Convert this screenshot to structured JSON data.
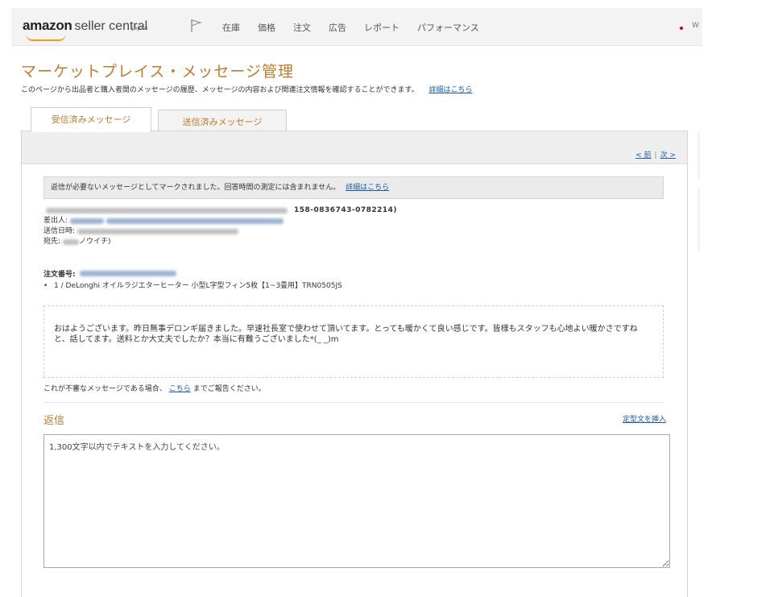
{
  "header": {
    "logo_brand": "amazon",
    "logo_product": "seller central",
    "logo_region": "japan",
    "nav_items": [
      "在庫",
      "価格",
      "注文",
      "広告",
      "レポート",
      "パフォーマンス"
    ],
    "user_text": "W"
  },
  "page": {
    "title": "マーケットプレイス・メッセージ管理",
    "description": "このページから出品者と購入者間のメッセージの履歴、メッセージの内容および関連注文情報を確認することができます。",
    "details_link": "詳細はこちら"
  },
  "tabs": [
    {
      "label": "受信済みメッセージ",
      "active": true
    },
    {
      "label": "送信済みメッセージ",
      "active": false
    }
  ],
  "pager": {
    "prev": "< 前",
    "separator": "|",
    "next": "次 >"
  },
  "message": {
    "notice": "返信が必要ないメッセージとしてマークされました。回答時間の測定には含まれません。",
    "notice_link": "詳細はこちら",
    "order_ref_number": "158-0836743-0782214)",
    "sender_label": "差出人:",
    "sent_label": "送信日時:",
    "to_label": "宛先:",
    "to_value": "ノウイチ)",
    "order_number_label": "注文番号:",
    "item_line": "1 / DeLonghi オイルラジエターヒーター 小型L字型フィン5枚【1~3畳用】TRN0505JS",
    "body": "おはようございます。昨日無事デロンギ届きました。早速社長室で使わせて頂いてます。とっても暖かくて良い感じです。皆様もスタッフも心地よい暖かさですねと、話してます。送料とか大丈夫でしたか？本当に有難うございました*(_ _)m",
    "report_prefix": "これが不審なメッセージである場合、",
    "report_link": "こちら",
    "report_suffix": "までご報告ください。"
  },
  "reply": {
    "title": "返信",
    "template_link": "定型文を挿入",
    "placeholder": "1,300文字以内でテキストを入力してください。"
  },
  "colors": {
    "accent": "#c17b2c",
    "link": "#1a5aa8",
    "logo_smile": "#f29a1d"
  }
}
